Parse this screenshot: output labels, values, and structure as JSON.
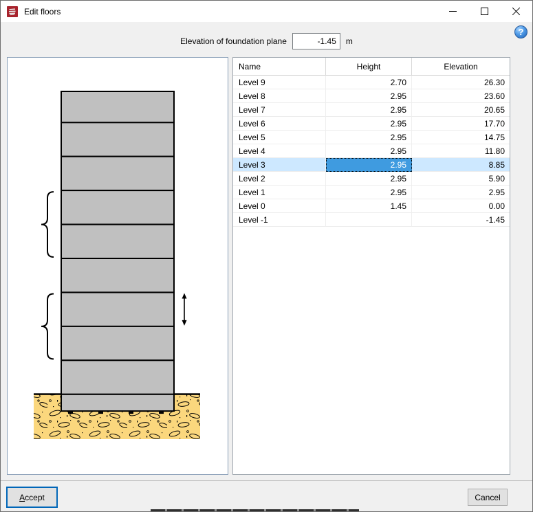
{
  "window": {
    "title": "Edit floors"
  },
  "help": {
    "glyph": "?"
  },
  "foundation": {
    "label": "Elevation of foundation plane",
    "value": "-1.45",
    "unit": "m"
  },
  "table": {
    "columns": [
      "Name",
      "Height",
      "Elevation"
    ],
    "rows": [
      {
        "name": "Level 9",
        "height": "2.70",
        "elevation": "26.30"
      },
      {
        "name": "Level 8",
        "height": "2.95",
        "elevation": "23.60"
      },
      {
        "name": "Level 7",
        "height": "2.95",
        "elevation": "20.65"
      },
      {
        "name": "Level 6",
        "height": "2.95",
        "elevation": "17.70"
      },
      {
        "name": "Level 5",
        "height": "2.95",
        "elevation": "14.75"
      },
      {
        "name": "Level 4",
        "height": "2.95",
        "elevation": "11.80"
      },
      {
        "name": "Level 3",
        "height": "2.95",
        "elevation": "8.85"
      },
      {
        "name": "Level 2",
        "height": "2.95",
        "elevation": "5.90"
      },
      {
        "name": "Level 1",
        "height": "2.95",
        "elevation": "2.95"
      },
      {
        "name": "Level 0",
        "height": "1.45",
        "elevation": "0.00"
      },
      {
        "name": "Level -1",
        "height": "",
        "elevation": "-1.45"
      }
    ],
    "selected_row": "Level 3",
    "selected_cell": "height"
  },
  "buttons": {
    "accept_accel": "A",
    "accept_rest": "ccept",
    "cancel": "Cancel"
  },
  "icons": [
    "app-icon",
    "minimize-icon",
    "maximize-icon",
    "close-icon",
    "help-icon"
  ],
  "colors": {
    "accent": "#0066b8",
    "selection_cell": "#3f9be0",
    "selection_row": "#cde8ff",
    "building_fill": "#c0c0c0",
    "soil_fill": "#fbd77d",
    "app_icon_red": "#a8232d"
  }
}
